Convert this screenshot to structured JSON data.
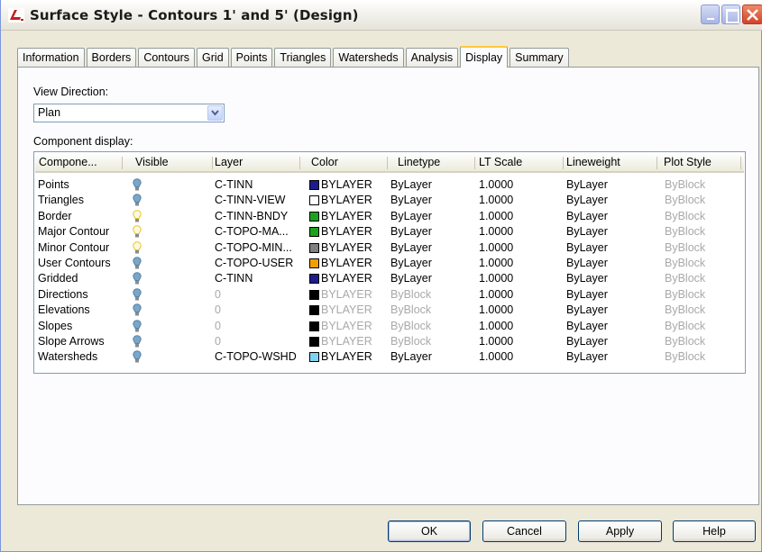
{
  "window": {
    "title": "Surface Style - Contours 1' and 5' (Design)",
    "icon": "civil3d-icon"
  },
  "tabs": [
    {
      "label": "Information",
      "active": false
    },
    {
      "label": "Borders",
      "active": false
    },
    {
      "label": "Contours",
      "active": false
    },
    {
      "label": "Grid",
      "active": false
    },
    {
      "label": "Points",
      "active": false
    },
    {
      "label": "Triangles",
      "active": false
    },
    {
      "label": "Watersheds",
      "active": false
    },
    {
      "label": "Analysis",
      "active": false
    },
    {
      "label": "Display",
      "active": true
    },
    {
      "label": "Summary",
      "active": false
    }
  ],
  "view_direction": {
    "label": "View Direction:",
    "value": "Plan"
  },
  "component_display": {
    "label": "Component display:",
    "columns": [
      "Compone...",
      "Visible",
      "Layer",
      "Color",
      "Linetype",
      "LT Scale",
      "Lineweight",
      "Plot Style"
    ],
    "rows": [
      {
        "component": "Points",
        "visible": true,
        "bulb_color": "#7aa7c9",
        "layer": "C-TINN",
        "swatch": "#1c1c8c",
        "color": "BYLAYER",
        "linetype": "ByLayer",
        "lt_scale": "1.0000",
        "lineweight": "ByLayer",
        "plot_style": "ByBlock",
        "dim": false
      },
      {
        "component": "Triangles",
        "visible": true,
        "bulb_color": "#7aa7c9",
        "layer": "C-TINN-VIEW",
        "swatch": "#ffffff",
        "color": "BYLAYER",
        "linetype": "ByLayer",
        "lt_scale": "1.0000",
        "lineweight": "ByLayer",
        "plot_style": "ByBlock",
        "dim": false
      },
      {
        "component": "Border",
        "visible": true,
        "bulb_color": "#e8c21a",
        "layer": "C-TINN-BNDY",
        "swatch": "#1ea11e",
        "color": "BYLAYER",
        "linetype": "ByLayer",
        "lt_scale": "1.0000",
        "lineweight": "ByLayer",
        "plot_style": "ByBlock",
        "dim": false
      },
      {
        "component": "Major Contour",
        "visible": true,
        "bulb_color": "#e8c21a",
        "layer": "C-TOPO-MA...",
        "swatch": "#1ea11e",
        "color": "BYLAYER",
        "linetype": "ByLayer",
        "lt_scale": "1.0000",
        "lineweight": "ByLayer",
        "plot_style": "ByBlock",
        "dim": false
      },
      {
        "component": "Minor Contour",
        "visible": true,
        "bulb_color": "#e8c21a",
        "layer": "C-TOPO-MIN...",
        "swatch": "#808080",
        "color": "BYLAYER",
        "linetype": "ByLayer",
        "lt_scale": "1.0000",
        "lineweight": "ByLayer",
        "plot_style": "ByBlock",
        "dim": false
      },
      {
        "component": "User Contours",
        "visible": true,
        "bulb_color": "#7aa7c9",
        "layer": "C-TOPO-USER",
        "swatch": "#f0a000",
        "color": "BYLAYER",
        "linetype": "ByLayer",
        "lt_scale": "1.0000",
        "lineweight": "ByLayer",
        "plot_style": "ByBlock",
        "dim": false
      },
      {
        "component": "Gridded",
        "visible": true,
        "bulb_color": "#7aa7c9",
        "layer": "C-TINN",
        "swatch": "#1c1c8c",
        "color": "BYLAYER",
        "linetype": "ByLayer",
        "lt_scale": "1.0000",
        "lineweight": "ByLayer",
        "plot_style": "ByBlock",
        "dim": false
      },
      {
        "component": "Directions",
        "visible": true,
        "bulb_color": "#7aa7c9",
        "layer": "0",
        "swatch": "#000000",
        "color": "BYLAYER",
        "linetype": "ByBlock",
        "lt_scale": "1.0000",
        "lineweight": "ByLayer",
        "plot_style": "ByBlock",
        "dim": true
      },
      {
        "component": "Elevations",
        "visible": true,
        "bulb_color": "#7aa7c9",
        "layer": "0",
        "swatch": "#000000",
        "color": "BYLAYER",
        "linetype": "ByBlock",
        "lt_scale": "1.0000",
        "lineweight": "ByLayer",
        "plot_style": "ByBlock",
        "dim": true
      },
      {
        "component": "Slopes",
        "visible": true,
        "bulb_color": "#7aa7c9",
        "layer": "0",
        "swatch": "#000000",
        "color": "BYLAYER",
        "linetype": "ByBlock",
        "lt_scale": "1.0000",
        "lineweight": "ByLayer",
        "plot_style": "ByBlock",
        "dim": true
      },
      {
        "component": "Slope Arrows",
        "visible": true,
        "bulb_color": "#7aa7c9",
        "layer": "0",
        "swatch": "#000000",
        "color": "BYLAYER",
        "linetype": "ByBlock",
        "lt_scale": "1.0000",
        "lineweight": "ByLayer",
        "plot_style": "ByBlock",
        "dim": true
      },
      {
        "component": "Watersheds",
        "visible": true,
        "bulb_color": "#7aa7c9",
        "layer": "C-TOPO-WSHD",
        "swatch": "#7fd3f0",
        "color": "BYLAYER",
        "linetype": "ByLayer",
        "lt_scale": "1.0000",
        "lineweight": "ByLayer",
        "plot_style": "ByBlock",
        "dim": false
      }
    ]
  },
  "buttons": {
    "ok": "OK",
    "cancel": "Cancel",
    "apply": "Apply",
    "help": "Help"
  }
}
